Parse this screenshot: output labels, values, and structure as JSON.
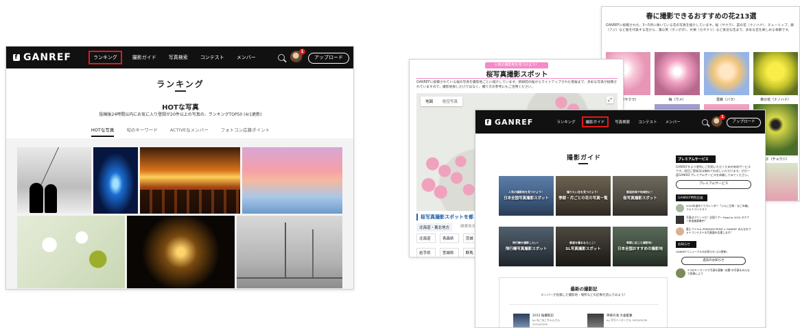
{
  "nav": {
    "logo": "GANREF",
    "links": [
      "ランキング",
      "撮影ガイド",
      "写真検索",
      "コンテスト",
      "メンバー"
    ],
    "upload": "アップロード",
    "notif_count": "1"
  },
  "ranking": {
    "title": "ランキング",
    "subtitle": "HOTな写真",
    "desc": "投稿後24時間以内にお気に入り登録が20件以上の写真の、ランキングTOP50 (4/1更新)",
    "tabs": [
      "HOTな写真",
      "旬のキーワード",
      "ACTIVEなメンバー",
      "フォトコン応募ポイント"
    ]
  },
  "sakura": {
    "banner": "人気の撮影地を見つけよう！",
    "title": "桜写真撮影スポット",
    "desc": "GANREFに投稿されている桜の写真を撮影地ごとに紹介しています。新緑前の桜からライトアップされた夜桜まで、多彩な写真が投稿されていますので、撮影地探しだけではなく、撮り方の参考にもご活用ください。",
    "map_tabs": [
      "地図",
      "航空写真"
    ],
    "region_title": "桜写真撮影スポットを都",
    "regions": [
      "北海道・東北地方",
      "関東地方"
    ],
    "prefs": [
      "北海道",
      "青森県",
      "茨城",
      "岩手県",
      "宮城県",
      "群馬"
    ]
  },
  "flowers": {
    "title": "春に撮影できるおすすめの花213選",
    "desc": "GANREFに投稿された、3〜5月に咲いている花の写真を紹介しています。桜（サクラ）、菜の花（ナノハナ）、チューリップ、藤（フジ）など春を代表する花から、蒲公英（タンポポ）、片栗（カタクリ）など身近な花まで、多彩な花を楽しめる季節です。",
    "labels": [
      "桜（サクラ）",
      "梅（ウメ）",
      "薔薇（バラ）",
      "菜の花（ナノハナ）",
      "丁子（チョウジ）"
    ]
  },
  "guide": {
    "title": "撮影ガイド",
    "cards": [
      {
        "sub": "人気の撮影地を見つけよう！",
        "main": "日本全国写真撮影スポット"
      },
      {
        "sub": "撮りたい花を見つけよう！",
        "main": "季節・月ごとの花の写真一覧"
      },
      {
        "sub": "都道府県や地域別に！",
        "main": "桜写真撮影スポット"
      },
      {
        "sub": "飛行機を撮影したい！",
        "main": "飛行機写真撮影スポット"
      },
      {
        "sub": "鉄道を撮るならここ！",
        "main": "SL写真撮影スポット"
      },
      {
        "sub": "季節に応じた撮影地！",
        "main": "日本全国おすすめの撮影地"
      }
    ],
    "latest_title": "最新の撮影記",
    "latest_sub": "メンバーが投稿した撮影地・場所などの記事を読んでみよう！",
    "posts": [
      {
        "title": "2015 桜撮影記",
        "by": "by ねこねこちゃんさん 2023/03/28"
      },
      {
        "title": "神楽の滝 大垂髪瀬",
        "by": "by 写写ハンターさん 2023/03/30"
      }
    ]
  },
  "sidebar": {
    "premium_title": "プレミアムサービス",
    "premium_desc": "GANREFをより便利にご利用いただくための有料サービスです。初回ご登録月は無料でお試しいただけます。ぜひ一度GANREFプレミアムサービスを体験してみてください。",
    "premium_btn": "プレミアムサービス",
    "special_title": "GANREF特別企画",
    "items": [
      "2024年波めくりカレンダー「いんこ日和・なごみ編」フォトコンテスト",
      "写真はプリントだ！全国ツアー Road to 2024 セミナー参加者募集中！",
      "富士フイルム PREMIUM PRINT x GANREF みんなのフォトコンテスト＆写真展を応援します！"
    ],
    "notice_title": "お知らせ",
    "notice_text": "GANREFリニューアルのお知らせ (2/2更新)",
    "notice_btn": "過去のお知らせ",
    "kw_text": "3つのキーワードで写真を募集 \"お題\"の写真をみんなで投稿しよう"
  }
}
